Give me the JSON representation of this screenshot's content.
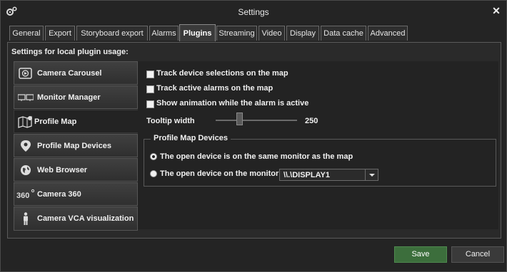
{
  "window": {
    "title": "Settings",
    "close_glyph": "✕",
    "app_icon": "gears-icon"
  },
  "tabs": [
    {
      "label": "General"
    },
    {
      "label": "Export"
    },
    {
      "label": "Storyboard export"
    },
    {
      "label": "Alarms"
    },
    {
      "label": "Plugins"
    },
    {
      "label": "Streaming"
    },
    {
      "label": "Video"
    },
    {
      "label": "Display"
    },
    {
      "label": "Data cache"
    },
    {
      "label": "Advanced"
    }
  ],
  "active_tab": "Plugins",
  "panel": {
    "header": "Settings for local plugin usage:"
  },
  "sidebar": {
    "items": [
      {
        "label": "Camera Carousel",
        "icon": "carousel-icon"
      },
      {
        "label": "Monitor Manager",
        "icon": "monitors-icon"
      },
      {
        "label": "Profile Map",
        "icon": "map-icon"
      },
      {
        "label": "Profile Map Devices",
        "icon": "map-pin-icon"
      },
      {
        "label": "Web Browser",
        "icon": "globe-icon"
      },
      {
        "label": "Camera 360",
        "icon": "360-icon"
      },
      {
        "label": "Camera VCA visualization",
        "icon": "person-icon"
      }
    ],
    "selected": "Profile Map"
  },
  "options": {
    "track_device": {
      "label": "Track device selections on the map",
      "checked": false
    },
    "track_alarms": {
      "label": "Track active alarms on the map",
      "checked": false
    },
    "show_animation": {
      "label": "Show animation while the alarm is active",
      "checked": false
    }
  },
  "tooltip_width": {
    "label": "Tooltip width",
    "value": "250"
  },
  "group": {
    "title": "Profile Map Devices",
    "radio_same_monitor": {
      "label": "The open device is on the same monitor as the map",
      "selected": true
    },
    "radio_other_monitor": {
      "label": "The open device on the monitor",
      "selected": false
    },
    "monitor_select": {
      "value": "\\\\.\\DISPLAY1"
    }
  },
  "buttons": {
    "save": "Save",
    "cancel": "Cancel"
  },
  "colors": {
    "save_button": "#3c6e3c",
    "background": "#242424"
  }
}
